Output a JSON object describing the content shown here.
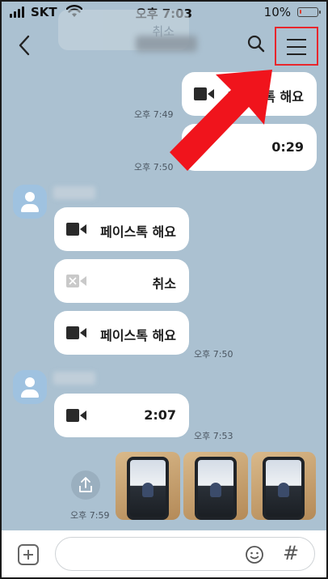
{
  "status_bar": {
    "carrier": "SKT",
    "time": "오후 7:03",
    "battery": "10%",
    "battery_level": 0.1
  },
  "header": {
    "back_icon": "chevron-left-icon",
    "search_icon": "search-icon",
    "menu_icon": "hamburger-menu-icon",
    "ghost_label": "취소",
    "highlight_color": "#e8262c"
  },
  "messages": {
    "m1": {
      "text": "페이스톡 해요",
      "time": "오후 7:49"
    },
    "m2": {
      "text": "0:29",
      "time": "오후 7:50"
    },
    "m3": {
      "text": "페이스톡 해요"
    },
    "m4": {
      "text": "취소"
    },
    "m5": {
      "text": "페이스톡 해요",
      "time": "오후 7:50"
    },
    "m6": {
      "text": "2:07",
      "time": "오후 7:53"
    },
    "photos": {
      "time": "오후 7:59",
      "count": 3
    }
  },
  "input_bar": {
    "plus_icon": "plus-icon",
    "emoji_icon": "emoji-icon",
    "hash_label": "#"
  },
  "annotation": {
    "arrow_color": "#f0141c"
  }
}
